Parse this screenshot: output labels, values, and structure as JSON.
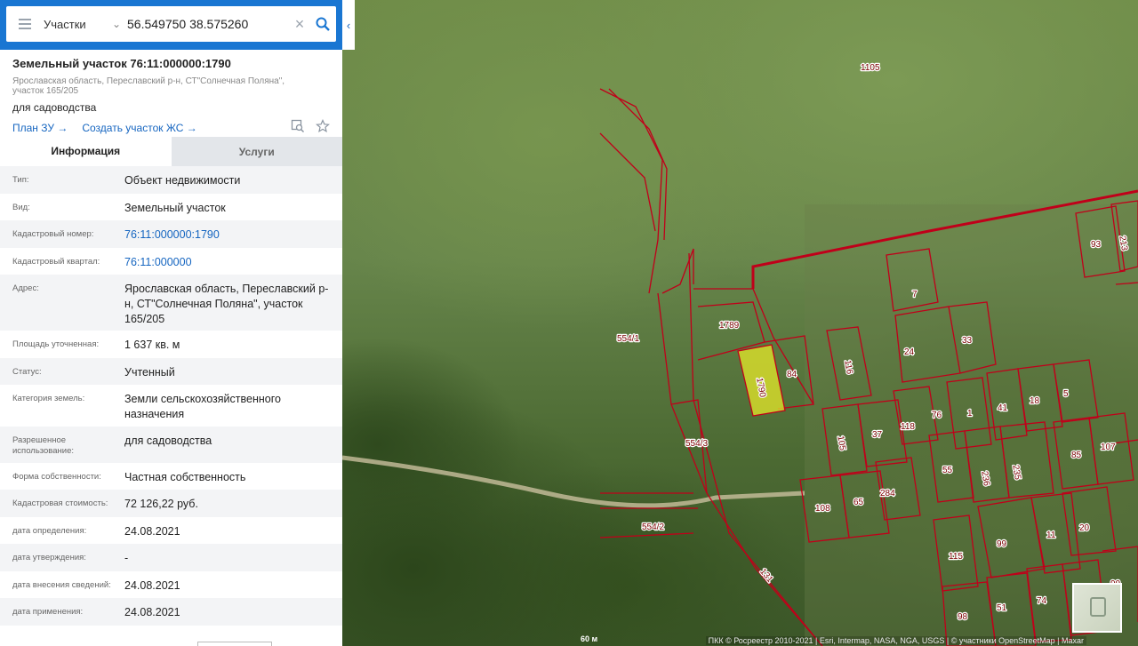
{
  "search": {
    "layer": "Участки",
    "query": "56.549750 38.575260"
  },
  "object": {
    "title": "Земельный участок 76:11:000000:1790",
    "address_short": "Ярославская область, Переславский р-н, СТ\"Солнечная Поляна\", участок 165/205",
    "usage": "для садоводства",
    "link_plan": "План ЗУ →",
    "link_create": "Создать участок ЖС →"
  },
  "tabs": [
    "Информация",
    "Услуги"
  ],
  "rows": [
    {
      "label": "Тип:",
      "value": "Объект недвижимости",
      "link": false,
      "h": 31
    },
    {
      "label": "Вид:",
      "value": "Земельный участок",
      "link": false,
      "h": 30
    },
    {
      "label": "Кадастровый номер:",
      "value": "76:11:000000:1790",
      "link": true,
      "h": 31
    },
    {
      "label": "Кадастровый квартал:",
      "value": "76:11:000000",
      "link": true,
      "h": 30
    },
    {
      "label": "Адрес:",
      "value": "Ярославская область, Переславский р-н, СТ\"Солнечная Поляна\", участок 165/205",
      "link": false,
      "h": 63
    },
    {
      "label": "Площадь уточненная:",
      "value": "1 637 кв. м",
      "link": false,
      "h": 31
    },
    {
      "label": "Статус:",
      "value": "Учтенный",
      "link": false,
      "h": 30
    },
    {
      "label": "Категория земель:",
      "value": "Земли сельскохозяйственного назначения",
      "link": false,
      "h": 47
    },
    {
      "label": "Разрешенное использование:",
      "value": "для садоводства",
      "link": false,
      "h": 41
    },
    {
      "label": "Форма собственности:",
      "value": "Частная собственность",
      "link": false,
      "h": 30
    },
    {
      "label": "Кадастровая стоимость:",
      "value": "72 126,22 руб.",
      "link": false,
      "h": 31
    },
    {
      "label": "дата определения:",
      "value": "24.08.2021",
      "link": false,
      "h": 30
    },
    {
      "label": "дата утверждения:",
      "value": "-",
      "link": false,
      "h": 31
    },
    {
      "label": "дата внесения сведений:",
      "value": "24.08.2021",
      "link": false,
      "h": 30
    },
    {
      "label": "дата применения:",
      "value": "24.08.2021",
      "link": false,
      "h": 31
    }
  ],
  "map": {
    "scale": "60 м",
    "attribution": "ПКК © Росреестр 2010-2021 | Esri, Intermap, NASA, NGA, USGS | © участники OpenStreetMap | Maxar",
    "parcel_color": "#c0001a",
    "selected_color": "#e6e82a",
    "parcels": [
      "1105",
      "554/1",
      "1789",
      "1790",
      "84",
      "554/3",
      "554/2",
      "131",
      "7",
      "93",
      "213",
      "24",
      "33",
      "116",
      "76",
      "1",
      "41",
      "18",
      "5",
      "118",
      "37",
      "105",
      "107",
      "55",
      "236",
      "235",
      "85",
      "284",
      "65",
      "108",
      "115",
      "99",
      "11",
      "20",
      "98",
      "51",
      "74",
      "91",
      "90"
    ]
  },
  "colors": {
    "accent": "#1976d2",
    "link": "#1565c0"
  }
}
